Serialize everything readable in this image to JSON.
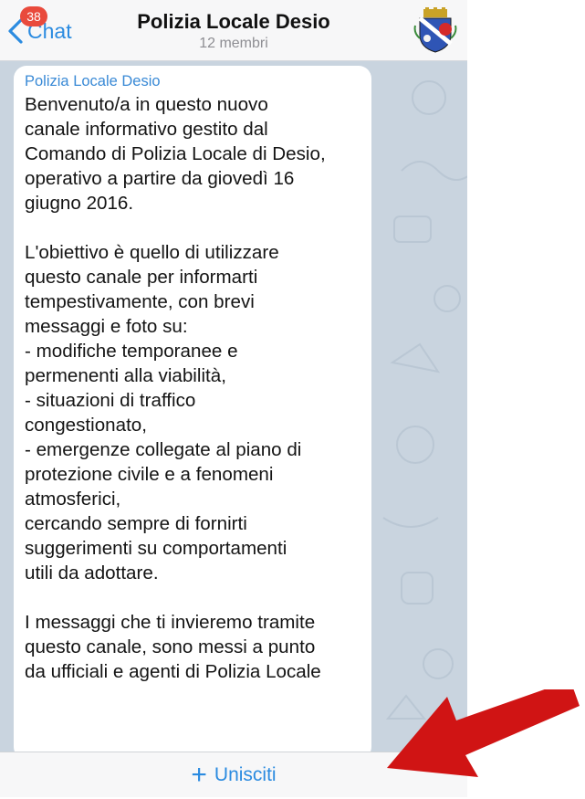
{
  "header": {
    "back_label": "Chat",
    "unread_badge": "38",
    "title": "Polizia Locale Desio",
    "subtitle": "12 membri",
    "avatar_icon": "coat-of-arms-icon"
  },
  "message": {
    "sender": "Polizia Locale Desio",
    "text": "Benvenuto/a in questo nuovo\ncanale informativo gestito dal\nComando di Polizia Locale di Desio,\noperativo a partire da giovedì 16\ngiugno 2016.\n\nL'obiettivo è quello di utilizzare\nquesto canale per informarti\ntempestivamente, con brevi\nmessaggi e foto su:\n- modifiche temporanee e\npermenenti alla viabilità,\n- situazioni di traffico\ncongestionato,\n- emergenze collegate al piano di\nprotezione civile e a fenomeni\natmosferici,\ncercando sempre di fornirti\nsuggerimenti su comportamenti\nutili da adottare.\n\nI messaggi che ti invieremo tramite\nquesto canale, sono messi a punto\nda ufficiali e agenti di Polizia Locale"
  },
  "footer": {
    "join_label": "Unisciti",
    "join_icon": "plus-icon"
  },
  "annotation": {
    "icon": "red-arrow-icon",
    "color": "#d01414"
  },
  "colors": {
    "accent": "#2b8be0",
    "badge": "#e94a3c",
    "sender": "#3a8ad6",
    "wallpaper": "#c9d4df"
  }
}
